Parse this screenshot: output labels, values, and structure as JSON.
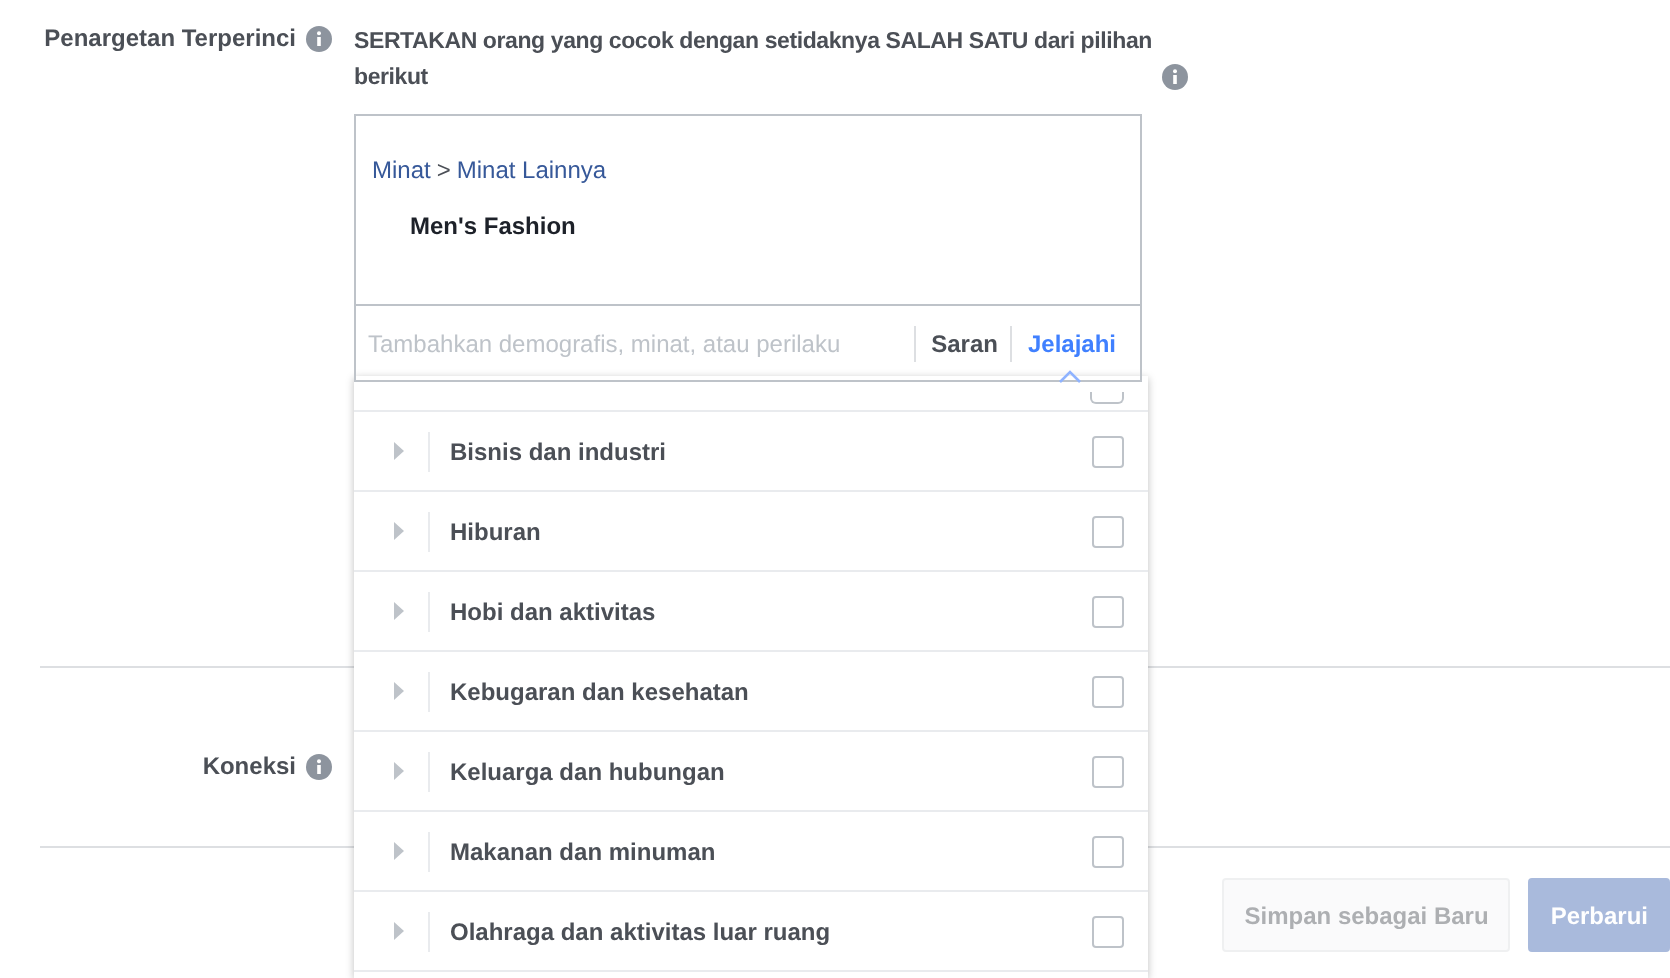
{
  "detailed_targeting": {
    "label": "Penargetan Terperinci",
    "description": "SERTAKAN orang yang cocok dengan setidaknya SALAH SATU dari pilihan berikut",
    "path": [
      "Minat",
      "Minat Lainnya"
    ],
    "path_separator": ">",
    "selected_item": "Men's Fashion",
    "search": {
      "placeholder": "Tambahkan demografis, minat, atau perilaku"
    },
    "modes": [
      {
        "label": "Saran",
        "selected": false
      },
      {
        "label": "Jelajahi",
        "selected": true
      }
    ],
    "partial_row": {
      "checked": false
    },
    "categories": [
      {
        "label": "Bisnis dan industri",
        "checked": false
      },
      {
        "label": "Hiburan",
        "checked": false
      },
      {
        "label": "Hobi dan aktivitas",
        "checked": false
      },
      {
        "label": "Kebugaran dan kesehatan",
        "checked": false
      },
      {
        "label": "Keluarga dan hubungan",
        "checked": false
      },
      {
        "label": "Makanan dan minuman",
        "checked": false
      },
      {
        "label": "Olahraga dan aktivitas luar ruang",
        "checked": false
      }
    ]
  },
  "connections": {
    "label": "Koneksi"
  },
  "buttons": [
    {
      "label": "Simpan sebagai Baru",
      "kind": "secondary",
      "disabled": true
    },
    {
      "label": "Perbarui",
      "kind": "primary",
      "disabled": true
    }
  ]
}
